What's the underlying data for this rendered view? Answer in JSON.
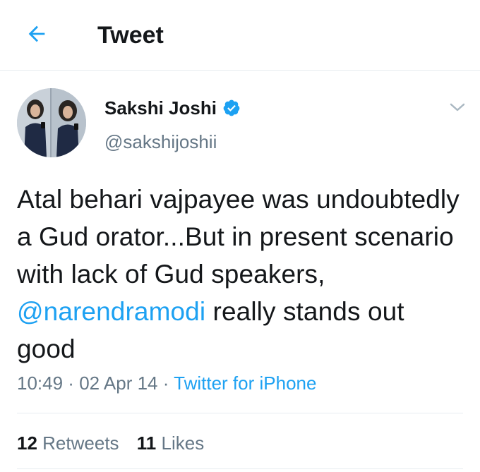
{
  "header": {
    "title": "Tweet",
    "back_icon": "arrow-left-icon"
  },
  "colors": {
    "accent": "#1da1f2",
    "text": "#14171a",
    "muted": "#657786",
    "divider": "#e6ecf0"
  },
  "user": {
    "display_name": "Sakshi Joshi",
    "handle": "@sakshijoshii",
    "verified_icon": "verified-badge-icon"
  },
  "tweet": {
    "text_before": "Atal behari vajpayee was undoubtedly a Gud orator...But in present scenario with lack of Gud speakers, ",
    "mention": "@narendramodi",
    "text_after": " really stands out good"
  },
  "meta": {
    "time": "10:49",
    "sep1": " · ",
    "date": "02 Apr 14",
    "sep2": " · ",
    "source": "Twitter for iPhone"
  },
  "stats": {
    "retweets_count": "12",
    "retweets_label": "Retweets",
    "likes_count": "11",
    "likes_label": "Likes"
  }
}
